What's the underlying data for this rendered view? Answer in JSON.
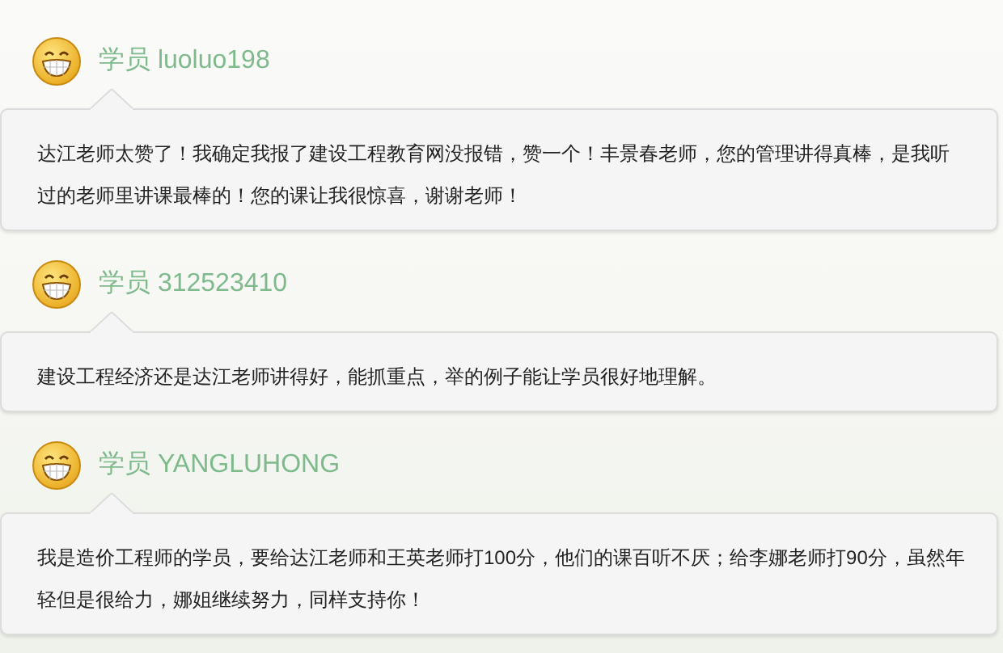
{
  "reviews": [
    {
      "author": "学员 luoluo198",
      "comment": "达江老师太赞了！我确定我报了建设工程教育网没报错，赞一个！丰景春老师，您的管理讲得真棒，是我听过的老师里讲课最棒的！您的课让我很惊喜，谢谢老师！"
    },
    {
      "author": "学员 312523410",
      "comment": "建设工程经济还是达江老师讲得好，能抓重点，举的例子能让学员很好地理解。"
    },
    {
      "author": "学员 YANGLUHONG",
      "comment": "我是造价工程师的学员，要给达江老师和王英老师打100分，他们的课百听不厌；给李娜老师打90分，虽然年轻但是很给力，娜姐继续努力，同样支持你！"
    }
  ]
}
